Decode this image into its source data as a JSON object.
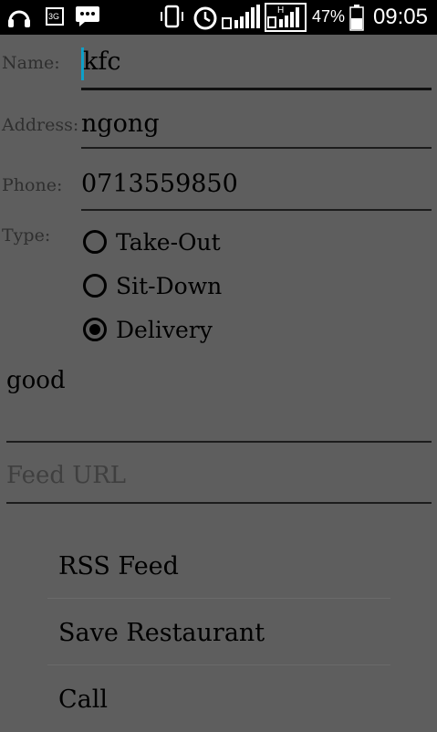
{
  "status_bar": {
    "icons": [
      "headphones-icon",
      "3g-data-icon",
      "sms-message-icon",
      "vibrate-icon",
      "alarm-icon",
      "signal-bars-icon",
      "hspa-signal-icon"
    ],
    "battery_percent": "47%",
    "time": "09:05"
  },
  "form": {
    "name_label": "Name:",
    "name_value": "kfc",
    "address_label": "Address:",
    "address_value": "ngong",
    "phone_label": "Phone:",
    "phone_value": "0713559850",
    "type_label": "Type:",
    "type_options": [
      "Take-Out",
      "Sit-Down",
      "Delivery"
    ],
    "type_selected": "Delivery",
    "notes_value": "good",
    "feed_placeholder": "Feed URL"
  },
  "menu": {
    "items": [
      "RSS Feed",
      "Save Restaurant",
      "Call"
    ]
  }
}
